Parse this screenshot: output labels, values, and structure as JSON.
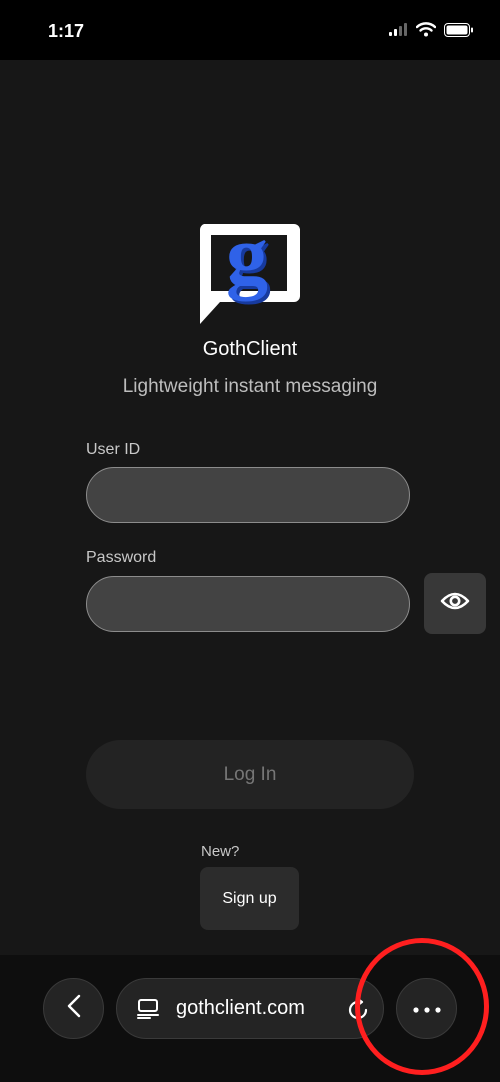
{
  "status_bar": {
    "time": "1:17",
    "icons": [
      "cellular-signal-icon",
      "wifi-icon",
      "battery-icon"
    ]
  },
  "app": {
    "name": "GothClient",
    "tagline": "Lightweight instant messaging",
    "logo_icon": "goth-logo-icon",
    "logo_letter": "g",
    "logo_color": "#2f62e8"
  },
  "login_form": {
    "user_id_label": "User ID",
    "user_id_value": "",
    "password_label": "Password",
    "password_value": "",
    "show_password_icon": "eye-icon",
    "login_button": "Log In",
    "new_label": "New?",
    "signup_button": "Sign up"
  },
  "browser_bar": {
    "back_icon": "chevron-left-icon",
    "page_icon": "page-icon",
    "url": "gothclient.com",
    "reload_icon": "reload-icon",
    "more_icon": "more-dots-icon"
  },
  "annotation": {
    "highlight_color": "#ff1f1f"
  }
}
